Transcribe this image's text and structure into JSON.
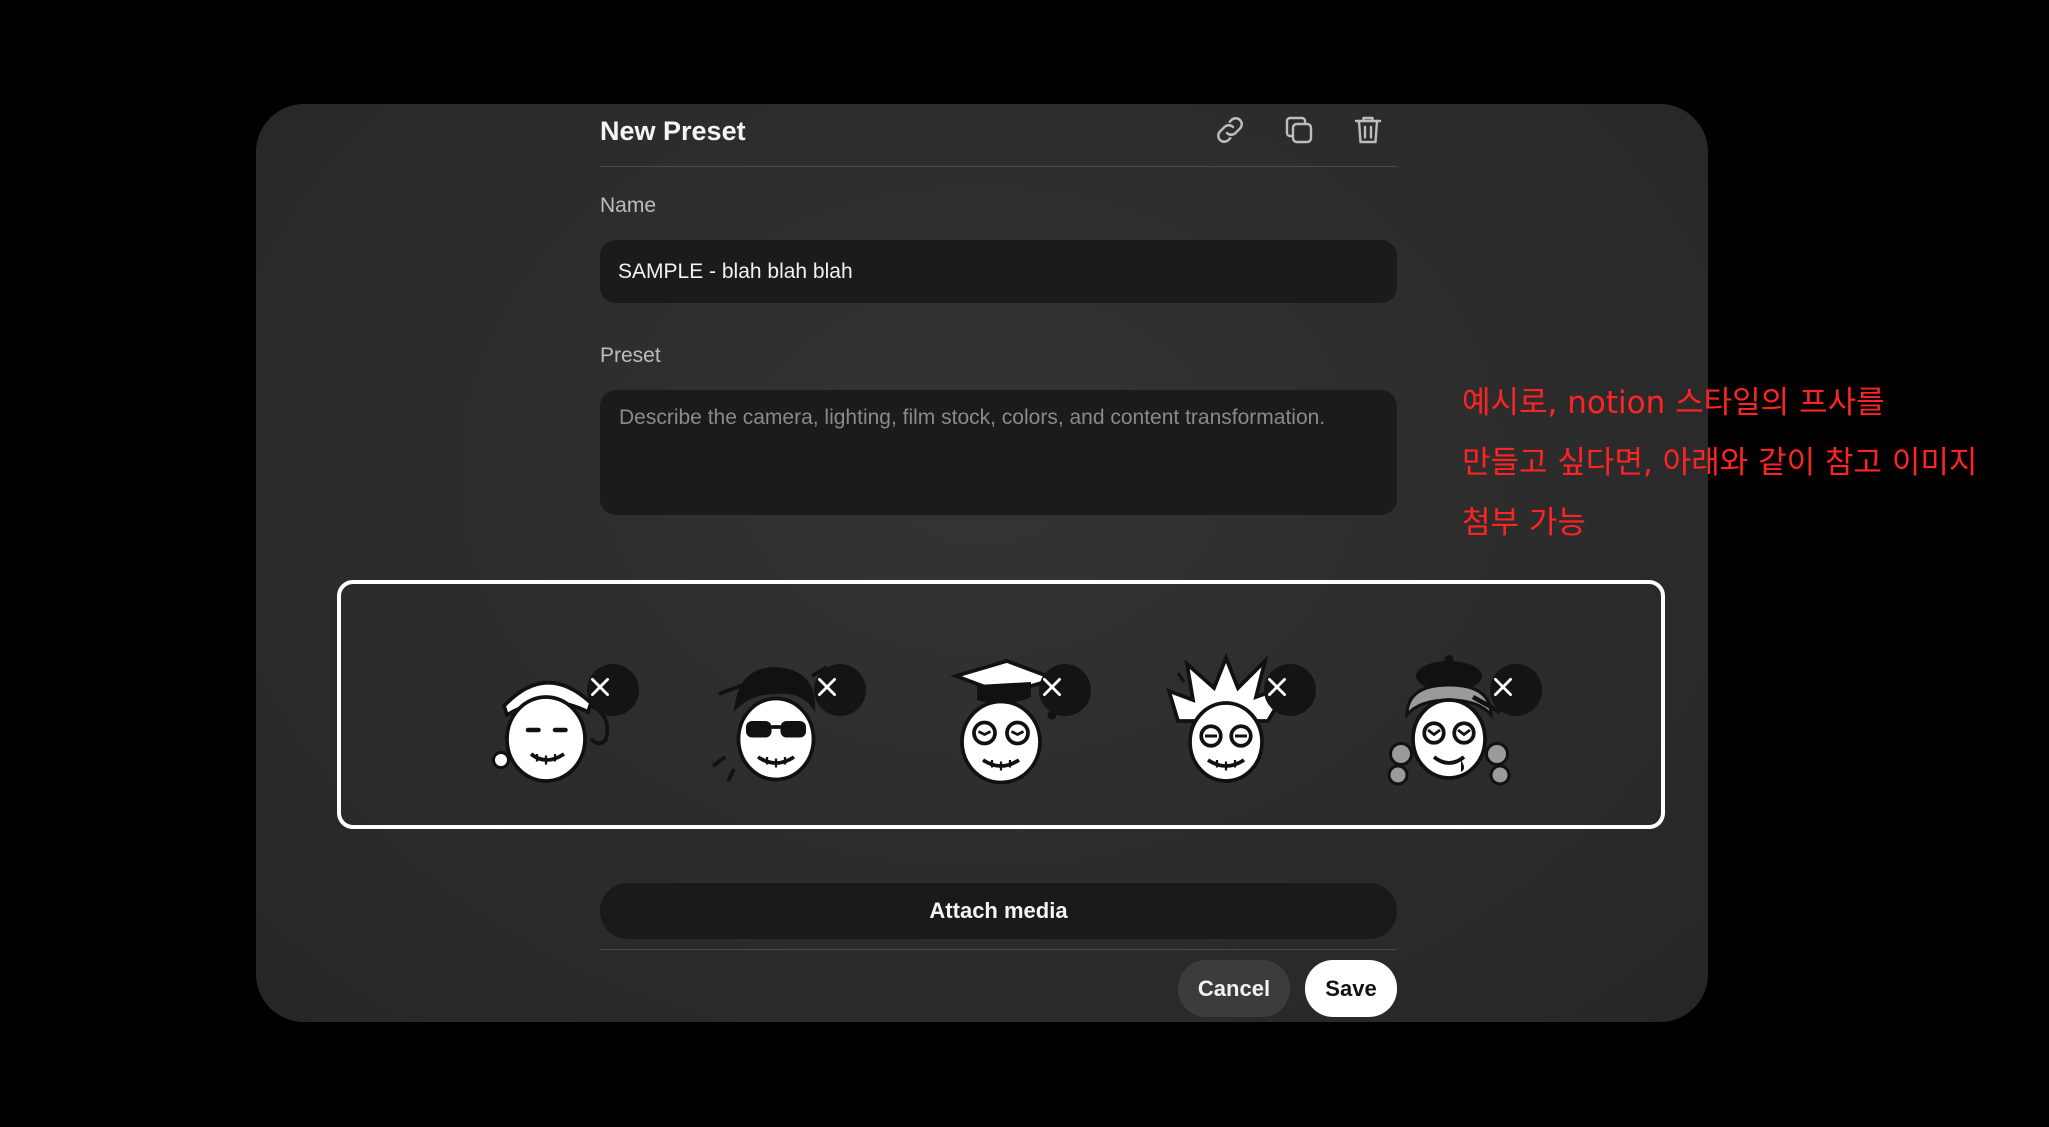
{
  "dialog": {
    "title": "New Preset",
    "icons": [
      "link-icon",
      "copy-icon",
      "trash-icon"
    ]
  },
  "form": {
    "name_label": "Name",
    "name_value": "SAMPLE - blah blah blah",
    "preset_label": "Preset",
    "preset_placeholder": "Describe the camera, lighting, film stock, colors, and content transformation."
  },
  "media": {
    "items": [
      {
        "name": "cap-character",
        "remove": "close-icon"
      },
      {
        "name": "sunglasses-character",
        "remove": "close-icon"
      },
      {
        "name": "graduate-character",
        "remove": "close-icon"
      },
      {
        "name": "spiky-hair-character",
        "remove": "close-icon"
      },
      {
        "name": "beret-character",
        "remove": "close-icon"
      }
    ],
    "attach_label": "Attach media"
  },
  "actions": {
    "cancel_label": "Cancel",
    "save_label": "Save"
  },
  "annotation": {
    "lines": [
      "예시로, notion 스타일의 프사를",
      "만들고 싶다면, 아래와 같이 참고 이미지",
      "첨부 가능"
    ],
    "color": "#ff2424"
  }
}
